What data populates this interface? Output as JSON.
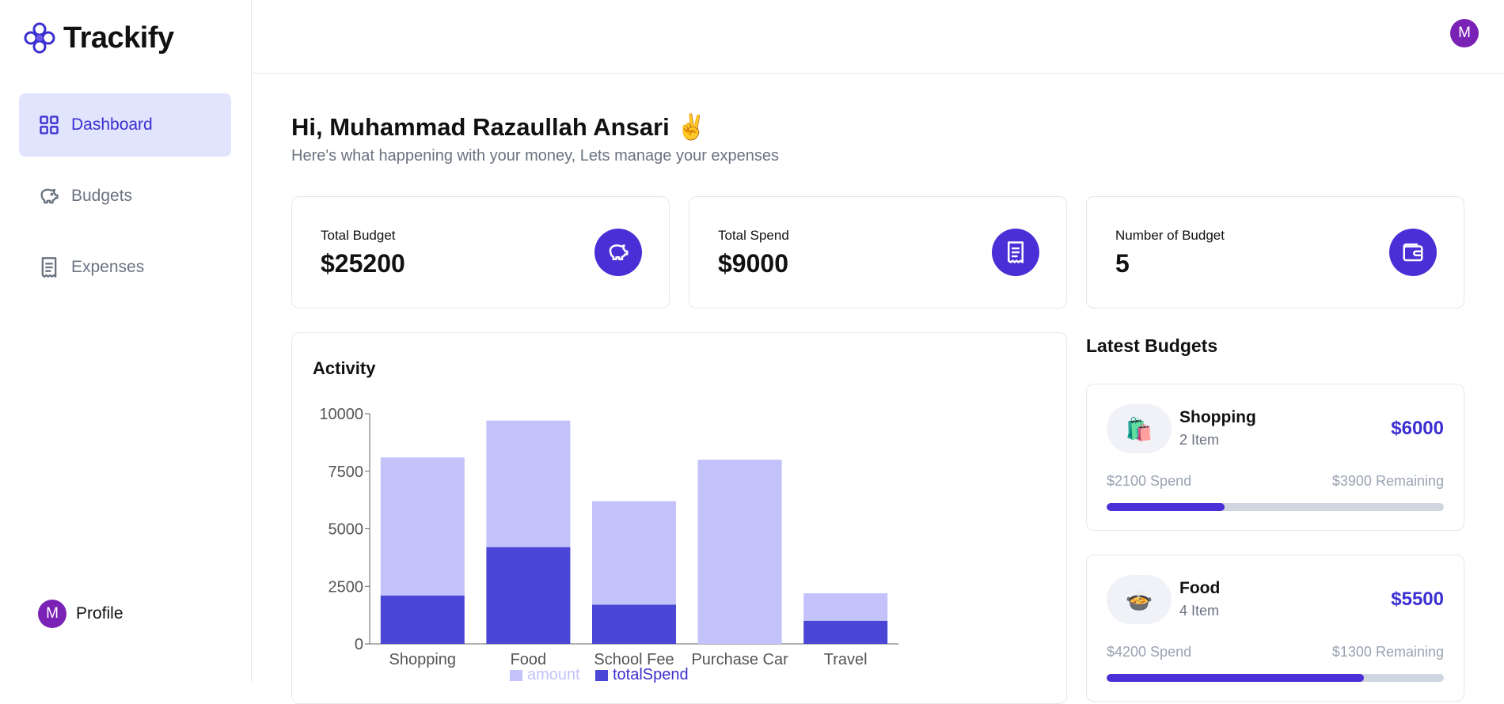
{
  "app": {
    "name": "Trackify"
  },
  "sidebar": {
    "items": [
      {
        "label": "Dashboard",
        "icon": "dashboard-icon",
        "active": true
      },
      {
        "label": "Budgets",
        "icon": "piggy-bank-icon",
        "active": false
      },
      {
        "label": "Expenses",
        "icon": "receipt-icon",
        "active": false
      }
    ],
    "profile": {
      "initial": "M",
      "label": "Profile"
    }
  },
  "topbar": {
    "avatar_initial": "M"
  },
  "greeting": {
    "title": "Hi, Muhammad Razaullah Ansari ✌️",
    "subtitle": "Here's what happening with your money, Lets manage your expenses"
  },
  "stats": [
    {
      "label": "Total Budget",
      "value": "$25200",
      "icon": "piggy-bank-icon"
    },
    {
      "label": "Total Spend",
      "value": "$9000",
      "icon": "receipt-icon"
    },
    {
      "label": "Number of Budget",
      "value": "5",
      "icon": "wallet-icon"
    }
  ],
  "activity": {
    "title": "Activity"
  },
  "chart_data": {
    "type": "bar",
    "stacked": true,
    "categories": [
      "Shopping",
      "Food",
      "School Fee",
      "Purchase Car",
      "Travel"
    ],
    "series": [
      {
        "name": "totalSpend",
        "values": [
          2100,
          4200,
          1700,
          0,
          1000
        ],
        "color": "#4a46d6"
      },
      {
        "name": "amount",
        "values": [
          6000,
          5500,
          4500,
          8000,
          1200
        ],
        "color": "#c3c2fb"
      }
    ],
    "yticks": [
      0,
      2500,
      5000,
      7500,
      10000
    ],
    "ylim": [
      0,
      10000
    ],
    "legend": "bottom"
  },
  "latest": {
    "title": "Latest Budgets",
    "budgets": [
      {
        "emoji": "🛍️",
        "name": "Shopping",
        "items": "2 Item",
        "amount": "$6000",
        "spend": "$2100 Spend",
        "remaining": "$3900 Remaining",
        "progress": 0.35
      },
      {
        "emoji": "🍲",
        "name": "Food",
        "items": "4 Item",
        "amount": "$5500",
        "spend": "$4200 Spend",
        "remaining": "$1300 Remaining",
        "progress": 0.7636
      }
    ]
  },
  "colors": {
    "accent": "#4b2fd6",
    "active_bg": "#e0e4fd",
    "avatar": "#7a22b5"
  }
}
